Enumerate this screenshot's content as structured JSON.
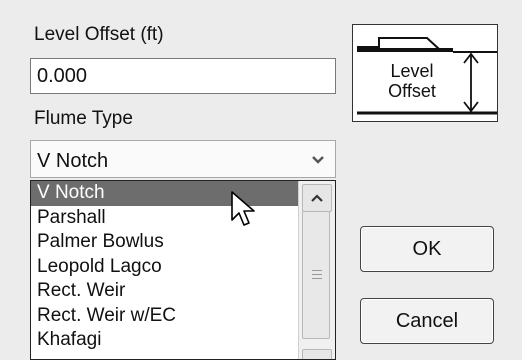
{
  "level_offset": {
    "label": "Level Offset (ft)",
    "value": "0.000"
  },
  "flume_type": {
    "label": "Flume Type",
    "selected": "V Notch",
    "options": [
      "V Notch",
      "Parshall",
      "Palmer Bowlus",
      "Leopold Lagco",
      "Rect. Weir",
      "Rect. Weir w/EC",
      "Khafagi"
    ],
    "highlighted_option": "V Notch"
  },
  "diagram": {
    "label_line1": "Level",
    "label_line2": "Offset"
  },
  "buttons": {
    "ok": "OK",
    "cancel": "Cancel"
  },
  "icons": {
    "combo_arrow": "chevron-down-icon",
    "scroll_up": "chevron-up-icon",
    "scroll_down": "chevron-down-icon",
    "cursor": "mouse-pointer-icon"
  }
}
